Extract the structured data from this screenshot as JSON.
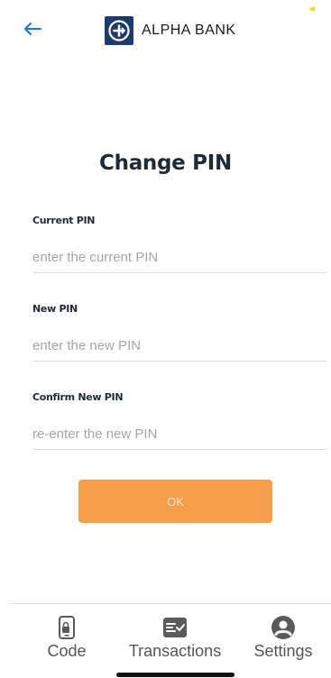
{
  "header": {
    "brand_name": "ALPHA BANK",
    "icons": {
      "back": "back-arrow-icon",
      "logo": "alpha-bank-logo-icon"
    },
    "accent_color": "#1a73e8",
    "brand_color": "#1d3a6b",
    "status_color": "#f5d90a"
  },
  "page": {
    "title": "Change PIN"
  },
  "form": {
    "current_pin": {
      "label": "Current PIN",
      "placeholder": "enter the current PIN",
      "value": ""
    },
    "new_pin": {
      "label": "New PIN",
      "placeholder": "enter the new PIN",
      "value": ""
    },
    "confirm_pin": {
      "label": "Confirm New PIN",
      "placeholder": "re-enter the new PIN",
      "value": ""
    },
    "submit_label": "OK",
    "submit_color": "#f79e4a"
  },
  "nav": {
    "items": [
      {
        "label": "Code",
        "icon": "phone-lock-icon"
      },
      {
        "label": "Transactions",
        "icon": "checklist-icon"
      },
      {
        "label": "Settings",
        "icon": "account-circle-icon"
      }
    ]
  }
}
